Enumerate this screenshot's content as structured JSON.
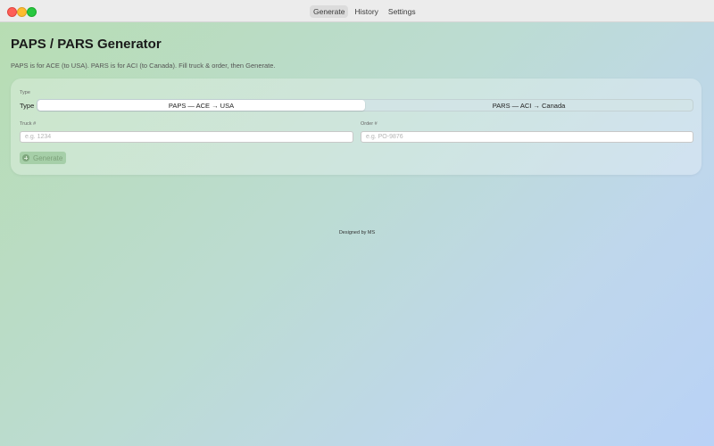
{
  "titlebar": {
    "tabs": [
      {
        "label": "Generate",
        "active": true
      },
      {
        "label": "History",
        "active": false
      },
      {
        "label": "Settings",
        "active": false
      }
    ]
  },
  "page": {
    "title": "PAPS / PARS Generator",
    "subtitle": "PAPS is for ACE (to USA). PARS is for ACI (to Canada). Fill truck & order, then Generate."
  },
  "form": {
    "type_section_label": "Type",
    "type_label": "Type",
    "type_options": [
      {
        "label": "PAPS — ACE → USA",
        "selected": true
      },
      {
        "label": "PARS — ACI → Canada",
        "selected": false
      }
    ],
    "truck": {
      "label": "Truck #",
      "placeholder": "e.g. 1234",
      "value": ""
    },
    "order": {
      "label": "Order #",
      "placeholder": "e.g. PO-9876",
      "value": ""
    },
    "generate_label": "Generate",
    "generate_icon": "plus-circle-icon"
  },
  "footer": {
    "text": "Designed by MS"
  },
  "colors": {
    "accent_green": "#7fa67d",
    "close": "#fe5f57",
    "minimize": "#febc2e",
    "maximize": "#28c840"
  }
}
